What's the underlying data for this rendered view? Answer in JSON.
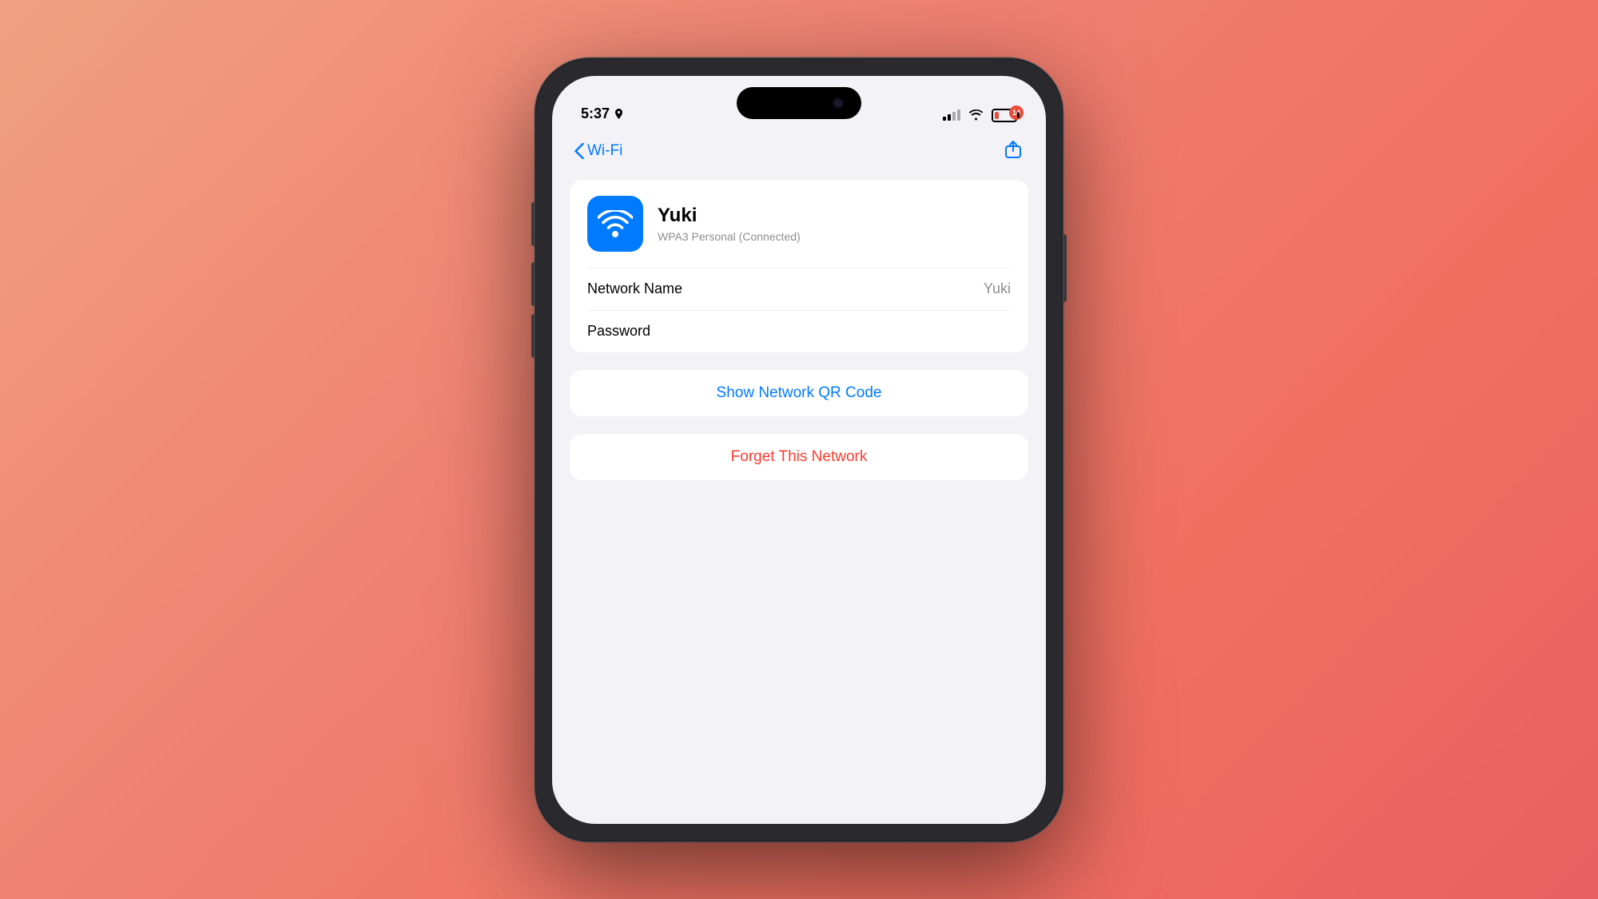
{
  "background": {
    "gradient_start": "#f0a080",
    "gradient_end": "#e86060"
  },
  "status_bar": {
    "time": "5:37",
    "battery_level": 14,
    "battery_color": "#e74c3c"
  },
  "nav": {
    "back_label": "Wi-Fi",
    "back_color": "#007AFF"
  },
  "network_card": {
    "name": "Yuki",
    "security": "WPA3 Personal (Connected)"
  },
  "rows": [
    {
      "label": "Network Name",
      "value": "Yuki"
    },
    {
      "label": "Password",
      "value": ""
    }
  ],
  "actions": {
    "qr_code_label": "Show Network QR Code",
    "forget_label": "Forget This Network"
  }
}
